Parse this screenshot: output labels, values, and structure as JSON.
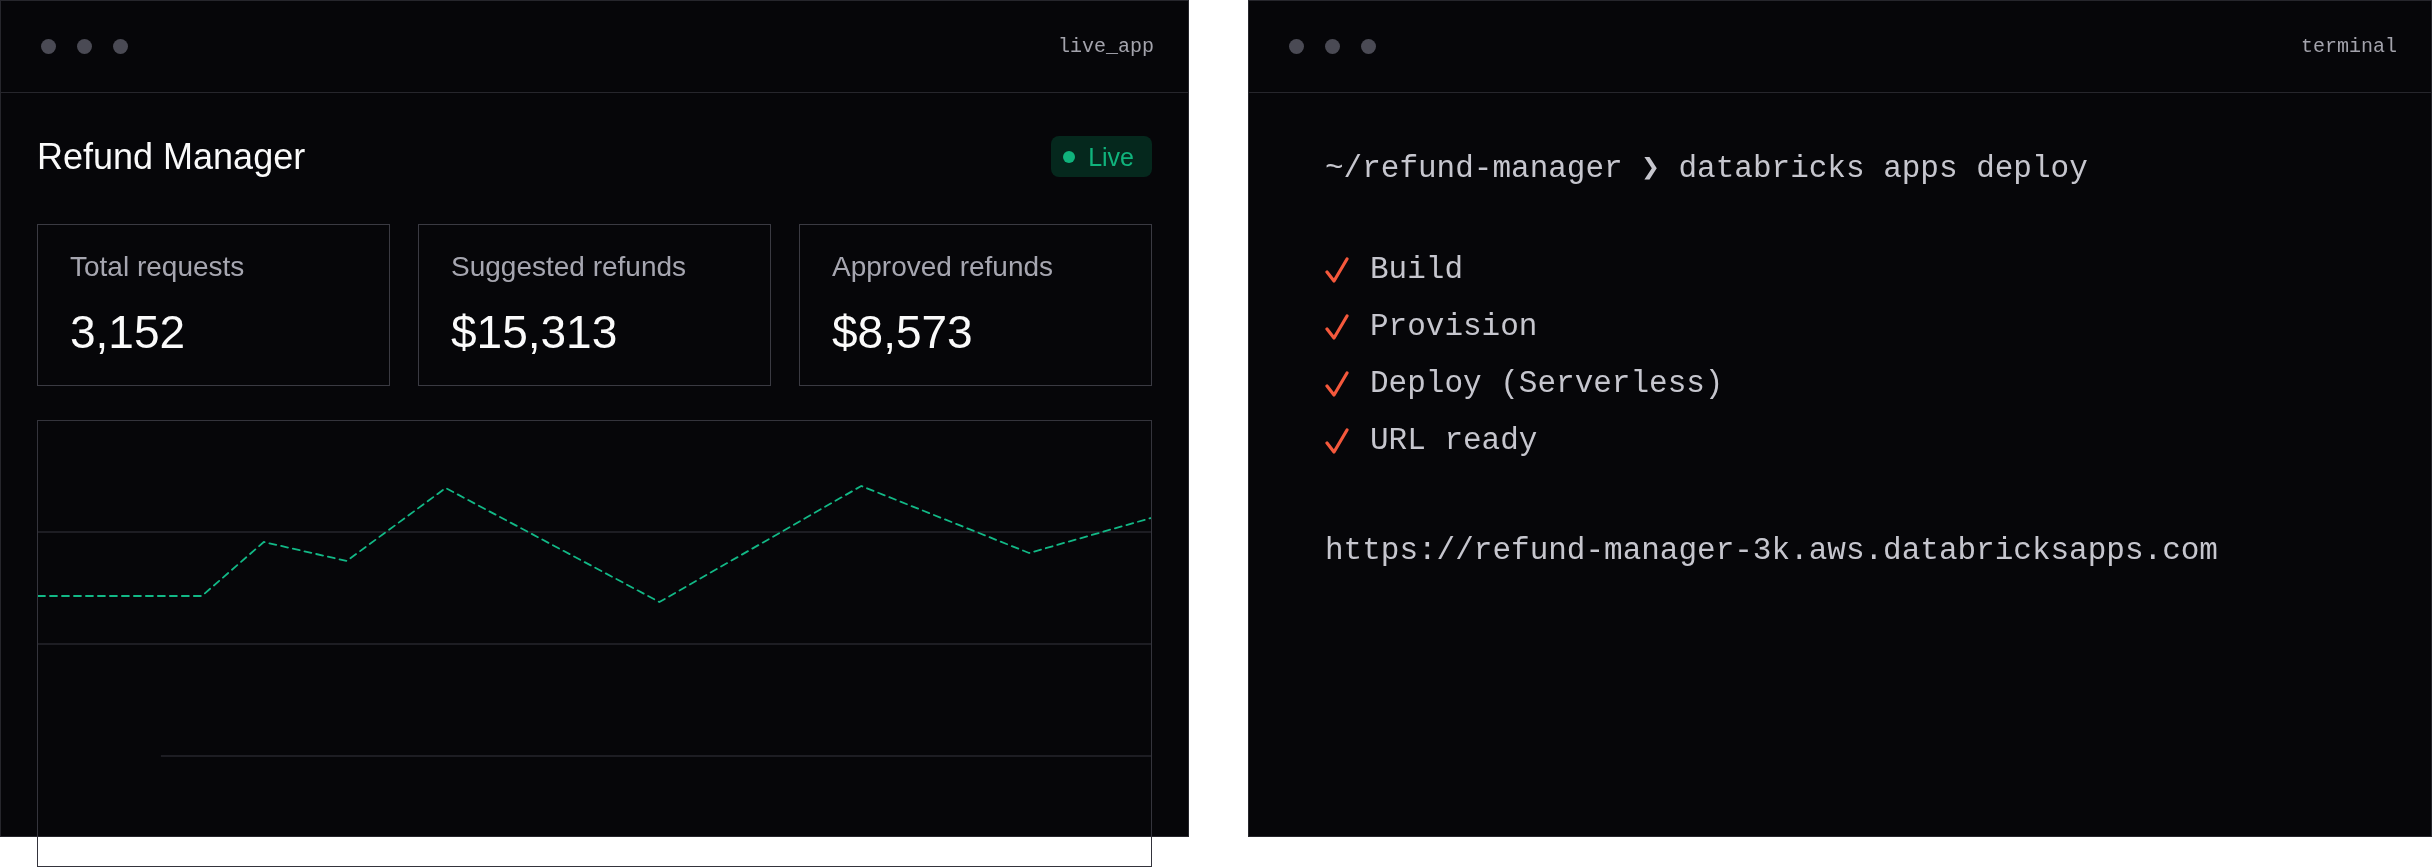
{
  "app_window": {
    "title": "live_app",
    "heading": "Refund Manager",
    "status_badge": {
      "label": "Live"
    },
    "stats": [
      {
        "label": "Total requests",
        "value": "3,152"
      },
      {
        "label": "Suggested refunds",
        "value": "$15,313"
      },
      {
        "label": "Approved refunds",
        "value": "$8,573"
      }
    ]
  },
  "terminal_window": {
    "title": "terminal",
    "command": "~/refund-manager ❯ databricks apps deploy",
    "steps": [
      {
        "label": "Build",
        "done": true
      },
      {
        "label": "Provision",
        "done": true
      },
      {
        "label": "Deploy (Serverless)",
        "done": true
      },
      {
        "label": "URL ready",
        "done": true
      }
    ],
    "url": "https://refund-manager-3k.aws.databricksapps.com"
  }
}
